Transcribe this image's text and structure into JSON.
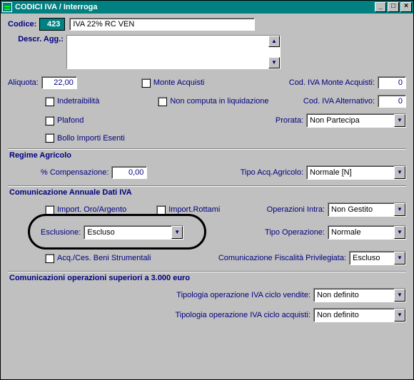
{
  "window": {
    "title": "CODICI IVA / Interroga"
  },
  "header": {
    "codice_label": "Codice:",
    "codice_value": "423",
    "codice_desc": "IVA 22% RC VEN",
    "descr_agg_label": "Descr. Agg.:",
    "descr_agg_value": ""
  },
  "main": {
    "aliquota_label": "Aliquota:",
    "aliquota_value": "22,00",
    "monte_acquisti": "Monte Acquisti",
    "cod_iva_monte_label": "Cod. IVA Monte Acquisti:",
    "cod_iva_monte_value": "0",
    "indetraibilita": "Indetraibilità",
    "non_computa": "Non computa in liquidazione",
    "cod_iva_alt_label": "Cod. IVA Alternativo:",
    "cod_iva_alt_value": "0",
    "plafond": "Plafond",
    "prorata_label": "Prorata:",
    "prorata_value": "Non Partecipa",
    "bollo": "Bollo Importi Esenti"
  },
  "regime": {
    "title": "Regime Agricolo",
    "compensazione_label": "% Compensazione:",
    "compensazione_value": "0,00",
    "tipo_acq_label": "Tipo Acq.Agricolo:",
    "tipo_acq_value": "Normale [N]"
  },
  "comunicazione": {
    "title": "Comunicazione Annuale Dati IVA",
    "import_oro": "Import. Oro/Argento",
    "import_rottami": "Import.Rottami",
    "operazioni_intra_label": "Operazioni Intra:",
    "operazioni_intra_value": "Non Gestito",
    "esclusione_label": "Esclusione:",
    "esclusione_value": "Escluso",
    "tipo_operazione_label": "Tipo Operazione:",
    "tipo_operazione_value": "Normale",
    "acq_ces": "Acq./Ces. Beni Strumentali",
    "com_fisc_label": "Comunicazione Fiscalità Privilegiata:",
    "com_fisc_value": "Escluso"
  },
  "com3000": {
    "title": "Comunicazioni operazioni superiori a 3.000 euro",
    "tipologia_vendite_label": "Tipologia operazione IVA ciclo vendite:",
    "tipologia_vendite_value": "Non definito",
    "tipologia_acquisti_label": "Tipologia operazione IVA ciclo acquisti:",
    "tipologia_acquisti_value": "Non definito"
  }
}
